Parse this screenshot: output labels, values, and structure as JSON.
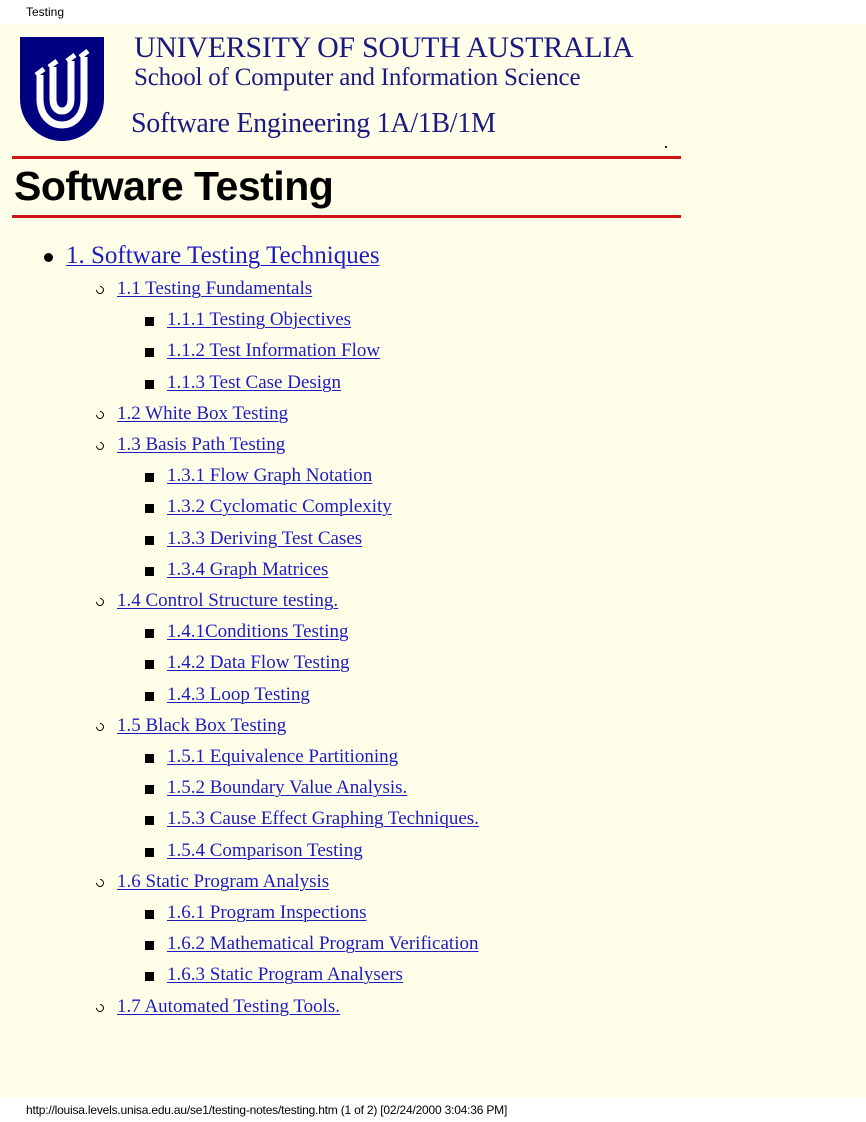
{
  "print_header": {
    "title": "Testing"
  },
  "header": {
    "university": "UNIVERSITY OF SOUTH AUSTRALIA",
    "school": "School of Computer and Information Science",
    "course": "Software Engineering 1A/1B/1M",
    "logo_color": "#000080"
  },
  "page_title": "Software Testing",
  "toc": [
    {
      "level": 1,
      "label": "1. Software Testing Techniques"
    },
    {
      "level": 2,
      "label": "1.1 Testing Fundamentals"
    },
    {
      "level": 3,
      "label": "1.1.1 Testing Objectives"
    },
    {
      "level": 3,
      "label": "1.1.2 Test Information Flow"
    },
    {
      "level": 3,
      "label": "1.1.3 Test Case Design"
    },
    {
      "level": 2,
      "label": "1.2 White Box Testing"
    },
    {
      "level": 2,
      "label": "1.3 Basis Path Testing"
    },
    {
      "level": 3,
      "label": "1.3.1 Flow Graph Notation"
    },
    {
      "level": 3,
      "label": "1.3.2 Cyclomatic Complexity"
    },
    {
      "level": 3,
      "label": "1.3.3 Deriving Test Cases"
    },
    {
      "level": 3,
      "label": "1.3.4 Graph Matrices"
    },
    {
      "level": 2,
      "label": "1.4 Control Structure testing."
    },
    {
      "level": 3,
      "label": "1.4.1Conditions Testing"
    },
    {
      "level": 3,
      "label": "1.4.2 Data Flow Testing"
    },
    {
      "level": 3,
      "label": "1.4.3 Loop Testing"
    },
    {
      "level": 2,
      "label": "1.5 Black Box Testing"
    },
    {
      "level": 3,
      "label": "1.5.1 Equivalence Partitioning"
    },
    {
      "level": 3,
      "label": "1.5.2 Boundary Value Analysis."
    },
    {
      "level": 3,
      "label": "1.5.3 Cause Effect Graphing Techniques."
    },
    {
      "level": 3,
      "label": "1.5.4 Comparison Testing"
    },
    {
      "level": 2,
      "label": "1.6 Static Program Analysis"
    },
    {
      "level": 3,
      "label": "1.6.1 Program Inspections"
    },
    {
      "level": 3,
      "label": "1.6.2 Mathematical Program Verification"
    },
    {
      "level": 3,
      "label": "1.6.3 Static Program Analysers"
    },
    {
      "level": 2,
      "label": "1.7 Automated Testing Tools."
    }
  ],
  "print_footer": {
    "text": "http://louisa.levels.unisa.edu.au/se1/testing-notes/testing.htm (1 of 2) [02/24/2000 3:04:36 PM]"
  },
  "colors": {
    "background": "#fffee8",
    "link": "#1c1cc0",
    "rule": "#d01414",
    "header_text": "#1a1a80"
  }
}
